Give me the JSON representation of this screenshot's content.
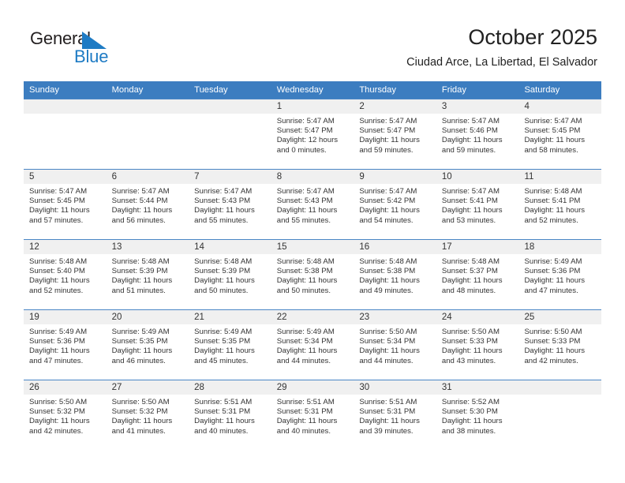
{
  "brand": {
    "name_part1": "General",
    "name_part2": "Blue",
    "accent_color": "#1e7bc4"
  },
  "header": {
    "title": "October 2025",
    "subtitle": "Ciudad Arce, La Libertad, El Salvador"
  },
  "calendar": {
    "header_color": "#3c7dc0",
    "weekdays": [
      "Sunday",
      "Monday",
      "Tuesday",
      "Wednesday",
      "Thursday",
      "Friday",
      "Saturday"
    ],
    "weeks": [
      [
        {
          "day": "",
          "sunrise": "",
          "sunset": "",
          "daylight_line1": "",
          "daylight_line2": ""
        },
        {
          "day": "",
          "sunrise": "",
          "sunset": "",
          "daylight_line1": "",
          "daylight_line2": ""
        },
        {
          "day": "",
          "sunrise": "",
          "sunset": "",
          "daylight_line1": "",
          "daylight_line2": ""
        },
        {
          "day": "1",
          "sunrise": "Sunrise: 5:47 AM",
          "sunset": "Sunset: 5:47 PM",
          "daylight_line1": "Daylight: 12 hours",
          "daylight_line2": "and 0 minutes."
        },
        {
          "day": "2",
          "sunrise": "Sunrise: 5:47 AM",
          "sunset": "Sunset: 5:47 PM",
          "daylight_line1": "Daylight: 11 hours",
          "daylight_line2": "and 59 minutes."
        },
        {
          "day": "3",
          "sunrise": "Sunrise: 5:47 AM",
          "sunset": "Sunset: 5:46 PM",
          "daylight_line1": "Daylight: 11 hours",
          "daylight_line2": "and 59 minutes."
        },
        {
          "day": "4",
          "sunrise": "Sunrise: 5:47 AM",
          "sunset": "Sunset: 5:45 PM",
          "daylight_line1": "Daylight: 11 hours",
          "daylight_line2": "and 58 minutes."
        }
      ],
      [
        {
          "day": "5",
          "sunrise": "Sunrise: 5:47 AM",
          "sunset": "Sunset: 5:45 PM",
          "daylight_line1": "Daylight: 11 hours",
          "daylight_line2": "and 57 minutes."
        },
        {
          "day": "6",
          "sunrise": "Sunrise: 5:47 AM",
          "sunset": "Sunset: 5:44 PM",
          "daylight_line1": "Daylight: 11 hours",
          "daylight_line2": "and 56 minutes."
        },
        {
          "day": "7",
          "sunrise": "Sunrise: 5:47 AM",
          "sunset": "Sunset: 5:43 PM",
          "daylight_line1": "Daylight: 11 hours",
          "daylight_line2": "and 55 minutes."
        },
        {
          "day": "8",
          "sunrise": "Sunrise: 5:47 AM",
          "sunset": "Sunset: 5:43 PM",
          "daylight_line1": "Daylight: 11 hours",
          "daylight_line2": "and 55 minutes."
        },
        {
          "day": "9",
          "sunrise": "Sunrise: 5:47 AM",
          "sunset": "Sunset: 5:42 PM",
          "daylight_line1": "Daylight: 11 hours",
          "daylight_line2": "and 54 minutes."
        },
        {
          "day": "10",
          "sunrise": "Sunrise: 5:47 AM",
          "sunset": "Sunset: 5:41 PM",
          "daylight_line1": "Daylight: 11 hours",
          "daylight_line2": "and 53 minutes."
        },
        {
          "day": "11",
          "sunrise": "Sunrise: 5:48 AM",
          "sunset": "Sunset: 5:41 PM",
          "daylight_line1": "Daylight: 11 hours",
          "daylight_line2": "and 52 minutes."
        }
      ],
      [
        {
          "day": "12",
          "sunrise": "Sunrise: 5:48 AM",
          "sunset": "Sunset: 5:40 PM",
          "daylight_line1": "Daylight: 11 hours",
          "daylight_line2": "and 52 minutes."
        },
        {
          "day": "13",
          "sunrise": "Sunrise: 5:48 AM",
          "sunset": "Sunset: 5:39 PM",
          "daylight_line1": "Daylight: 11 hours",
          "daylight_line2": "and 51 minutes."
        },
        {
          "day": "14",
          "sunrise": "Sunrise: 5:48 AM",
          "sunset": "Sunset: 5:39 PM",
          "daylight_line1": "Daylight: 11 hours",
          "daylight_line2": "and 50 minutes."
        },
        {
          "day": "15",
          "sunrise": "Sunrise: 5:48 AM",
          "sunset": "Sunset: 5:38 PM",
          "daylight_line1": "Daylight: 11 hours",
          "daylight_line2": "and 50 minutes."
        },
        {
          "day": "16",
          "sunrise": "Sunrise: 5:48 AM",
          "sunset": "Sunset: 5:38 PM",
          "daylight_line1": "Daylight: 11 hours",
          "daylight_line2": "and 49 minutes."
        },
        {
          "day": "17",
          "sunrise": "Sunrise: 5:48 AM",
          "sunset": "Sunset: 5:37 PM",
          "daylight_line1": "Daylight: 11 hours",
          "daylight_line2": "and 48 minutes."
        },
        {
          "day": "18",
          "sunrise": "Sunrise: 5:49 AM",
          "sunset": "Sunset: 5:36 PM",
          "daylight_line1": "Daylight: 11 hours",
          "daylight_line2": "and 47 minutes."
        }
      ],
      [
        {
          "day": "19",
          "sunrise": "Sunrise: 5:49 AM",
          "sunset": "Sunset: 5:36 PM",
          "daylight_line1": "Daylight: 11 hours",
          "daylight_line2": "and 47 minutes."
        },
        {
          "day": "20",
          "sunrise": "Sunrise: 5:49 AM",
          "sunset": "Sunset: 5:35 PM",
          "daylight_line1": "Daylight: 11 hours",
          "daylight_line2": "and 46 minutes."
        },
        {
          "day": "21",
          "sunrise": "Sunrise: 5:49 AM",
          "sunset": "Sunset: 5:35 PM",
          "daylight_line1": "Daylight: 11 hours",
          "daylight_line2": "and 45 minutes."
        },
        {
          "day": "22",
          "sunrise": "Sunrise: 5:49 AM",
          "sunset": "Sunset: 5:34 PM",
          "daylight_line1": "Daylight: 11 hours",
          "daylight_line2": "and 44 minutes."
        },
        {
          "day": "23",
          "sunrise": "Sunrise: 5:50 AM",
          "sunset": "Sunset: 5:34 PM",
          "daylight_line1": "Daylight: 11 hours",
          "daylight_line2": "and 44 minutes."
        },
        {
          "day": "24",
          "sunrise": "Sunrise: 5:50 AM",
          "sunset": "Sunset: 5:33 PM",
          "daylight_line1": "Daylight: 11 hours",
          "daylight_line2": "and 43 minutes."
        },
        {
          "day": "25",
          "sunrise": "Sunrise: 5:50 AM",
          "sunset": "Sunset: 5:33 PM",
          "daylight_line1": "Daylight: 11 hours",
          "daylight_line2": "and 42 minutes."
        }
      ],
      [
        {
          "day": "26",
          "sunrise": "Sunrise: 5:50 AM",
          "sunset": "Sunset: 5:32 PM",
          "daylight_line1": "Daylight: 11 hours",
          "daylight_line2": "and 42 minutes."
        },
        {
          "day": "27",
          "sunrise": "Sunrise: 5:50 AM",
          "sunset": "Sunset: 5:32 PM",
          "daylight_line1": "Daylight: 11 hours",
          "daylight_line2": "and 41 minutes."
        },
        {
          "day": "28",
          "sunrise": "Sunrise: 5:51 AM",
          "sunset": "Sunset: 5:31 PM",
          "daylight_line1": "Daylight: 11 hours",
          "daylight_line2": "and 40 minutes."
        },
        {
          "day": "29",
          "sunrise": "Sunrise: 5:51 AM",
          "sunset": "Sunset: 5:31 PM",
          "daylight_line1": "Daylight: 11 hours",
          "daylight_line2": "and 40 minutes."
        },
        {
          "day": "30",
          "sunrise": "Sunrise: 5:51 AM",
          "sunset": "Sunset: 5:31 PM",
          "daylight_line1": "Daylight: 11 hours",
          "daylight_line2": "and 39 minutes."
        },
        {
          "day": "31",
          "sunrise": "Sunrise: 5:52 AM",
          "sunset": "Sunset: 5:30 PM",
          "daylight_line1": "Daylight: 11 hours",
          "daylight_line2": "and 38 minutes."
        },
        {
          "day": "",
          "sunrise": "",
          "sunset": "",
          "daylight_line1": "",
          "daylight_line2": ""
        }
      ]
    ]
  }
}
